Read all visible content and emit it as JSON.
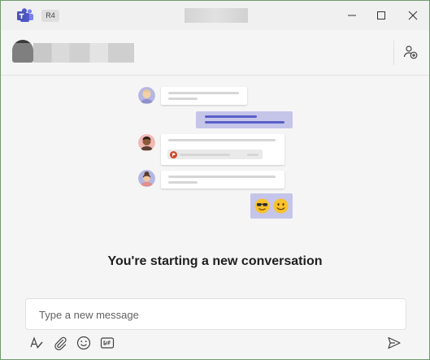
{
  "titlebar": {
    "tenant_badge": "R4",
    "icons": [
      "teams-logo",
      "minimize-icon",
      "maximize-icon",
      "close-icon"
    ]
  },
  "header": {
    "icons": [
      "add-people-icon"
    ]
  },
  "empty_state": {
    "headline": "You're starting a new conversation"
  },
  "compose": {
    "placeholder": "Type a new message",
    "value": "",
    "tools": [
      "format-icon",
      "attach-icon",
      "emoji-icon",
      "gif-icon"
    ],
    "send_icon": "send-icon"
  },
  "colors": {
    "accent": "#5b5fc7",
    "bubble_self": "#c5c5ea",
    "teams_logo": "#4b53bc"
  }
}
